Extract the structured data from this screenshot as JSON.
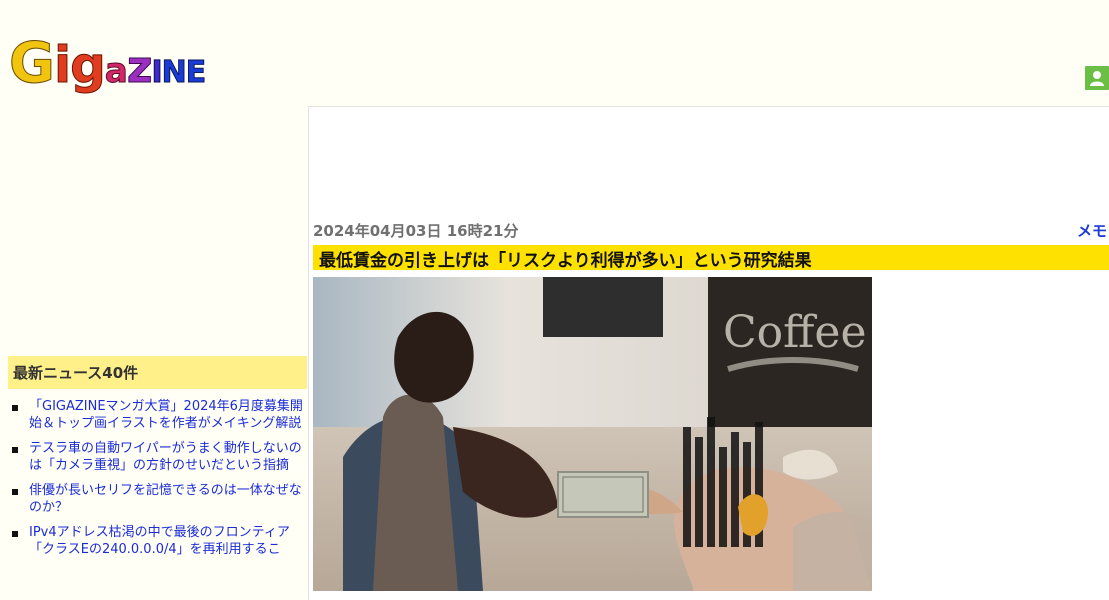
{
  "site": {
    "logo_letters": [
      "G",
      "i",
      "g",
      "a",
      "z",
      "I",
      "N",
      "E"
    ]
  },
  "article": {
    "date": "2024年04月03日 16時21分",
    "category": "メモ",
    "title": "最低賃金の引き上げは「リスクより利得が多い」という研究結果"
  },
  "sidebar": {
    "header": "最新ニュース40件",
    "items": [
      {
        "label": "「GIGAZINEマンガ大賞」2024年6月度募集開始＆トップ画イラストを作者がメイキング解説"
      },
      {
        "label": "テスラ車の自動ワイパーがうまく動作しないのは「カメラ重視」の方針のせいだという指摘"
      },
      {
        "label": "俳優が長いセリフを記憶できるのは一体なぜなのか？"
      },
      {
        "label": "IPv4アドレス枯渇の中で最後のフロンティア「クラスEの240.0.0.0/4」を再利用するこ"
      }
    ]
  },
  "icons": {
    "user": "user-icon"
  },
  "colors": {
    "headline_bar": "#ffe100",
    "sidebar_header": "#fff08a",
    "link": "#1b2bd6",
    "user_icon": "#6bbf45"
  }
}
